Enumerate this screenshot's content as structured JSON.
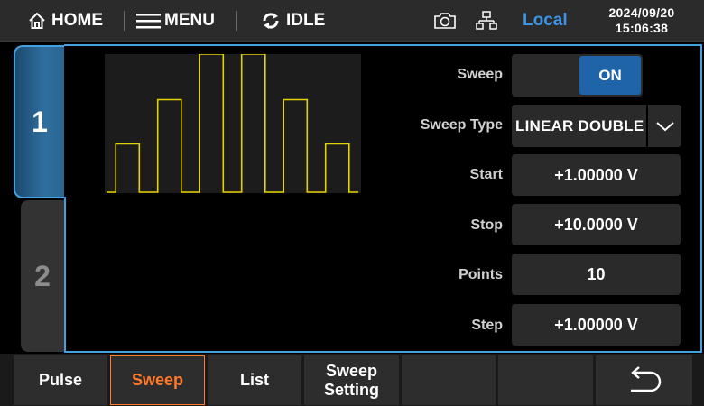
{
  "topbar": {
    "home_label": "HOME",
    "menu_label": "MENU",
    "status_label": "IDLE",
    "mode_label": "Local",
    "date": "2024/09/20",
    "time": "15:06:38"
  },
  "channels": [
    {
      "label": "1",
      "active": true
    },
    {
      "label": "2",
      "active": false
    }
  ],
  "waveform": {
    "color": "#e6d200",
    "levels": [
      0.35,
      0.67,
      1.0,
      1.0,
      0.67,
      0.35
    ]
  },
  "settings": {
    "sweep": {
      "label": "Sweep",
      "value": "ON"
    },
    "sweep_type": {
      "label": "Sweep Type",
      "value": "LINEAR DOUBLE"
    },
    "start": {
      "label": "Start",
      "value": "+1.00000 V"
    },
    "stop": {
      "label": "Stop",
      "value": "+10.0000 V"
    },
    "points": {
      "label": "Points",
      "value": "10"
    },
    "step": {
      "label": "Step",
      "value": "+1.00000 V"
    }
  },
  "softkeys": {
    "pulse": "Pulse",
    "sweep": "Sweep",
    "list": "List",
    "sweep_setting_line1": "Sweep",
    "sweep_setting_line2": "Setting"
  },
  "colors": {
    "accent": "#45a0de",
    "active_softkey": "#ff7a2a",
    "local": "#3d93e6",
    "toggle_on": "#1f63a8"
  }
}
